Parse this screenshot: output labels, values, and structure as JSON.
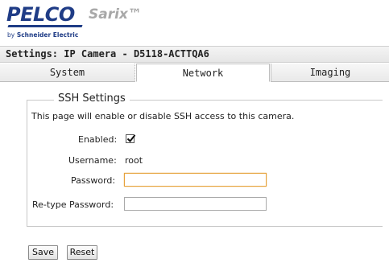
{
  "header": {
    "brand": "PELCO",
    "product": "Sarix™",
    "byline_prefix": "by",
    "byline_company": "Schneider Electric"
  },
  "title_bar": {
    "text": "Settings: IP Camera - D5118-ACTTQA6"
  },
  "tabs": [
    {
      "label": "System",
      "active": false
    },
    {
      "label": "Network",
      "active": true
    },
    {
      "label": "Imaging",
      "active": false
    }
  ],
  "ssh": {
    "legend": "SSH Settings",
    "description": "This page will enable or disable SSH access to this camera.",
    "enabled_label": "Enabled:",
    "enabled": true,
    "username_label": "Username:",
    "username_value": "root",
    "password_label": "Password:",
    "password_value": "",
    "retype_label": "Re-type Password:",
    "retype_value": ""
  },
  "buttons": {
    "save": "Save",
    "reset": "Reset"
  },
  "colors": {
    "brand_blue": "#1f3c86",
    "focus_border": "#e6a23c"
  }
}
